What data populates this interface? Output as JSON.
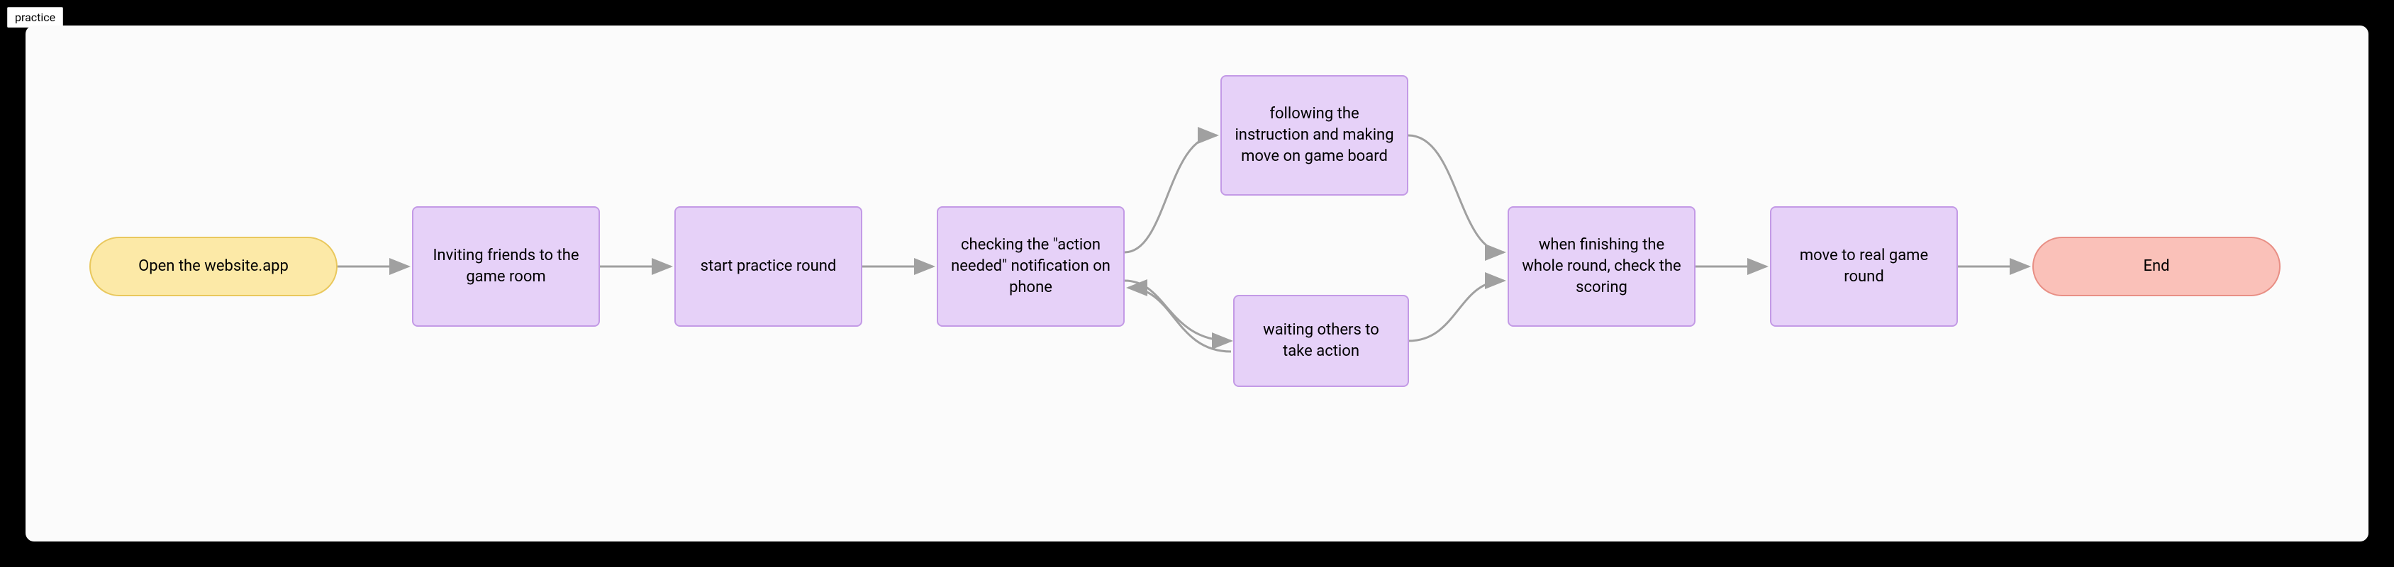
{
  "tab_label": "practice",
  "nodes": {
    "start": "Open the website.app",
    "invite": "Inviting friends to the game room",
    "practice": "start practice round",
    "check": "checking the \"action needed\" notification on phone",
    "follow": "following the instruction and making move on game board",
    "wait": "waiting others to take action",
    "finish": "when finishing the whole round, check the scoring",
    "move_real": "move to real game round",
    "end": "End"
  },
  "chart_data": {
    "type": "flowchart",
    "nodes": [
      {
        "id": "start",
        "type": "terminator",
        "label": "Open the website.app"
      },
      {
        "id": "invite",
        "type": "process",
        "label": "Inviting friends to the game room"
      },
      {
        "id": "practice",
        "type": "process",
        "label": "start practice round"
      },
      {
        "id": "check",
        "type": "process",
        "label": "checking the \"action needed\" notification on phone"
      },
      {
        "id": "follow",
        "type": "process",
        "label": "following the instruction and making move on game board"
      },
      {
        "id": "wait",
        "type": "process",
        "label": "waiting others to take action"
      },
      {
        "id": "finish",
        "type": "process",
        "label": "when finishing the whole round, check the scoring"
      },
      {
        "id": "move_real",
        "type": "process",
        "label": "move to real game round"
      },
      {
        "id": "end",
        "type": "terminator",
        "label": "End"
      }
    ],
    "edges": [
      {
        "from": "start",
        "to": "invite"
      },
      {
        "from": "invite",
        "to": "practice"
      },
      {
        "from": "practice",
        "to": "check"
      },
      {
        "from": "check",
        "to": "follow"
      },
      {
        "from": "check",
        "to": "wait"
      },
      {
        "from": "follow",
        "to": "finish"
      },
      {
        "from": "wait",
        "to": "finish"
      },
      {
        "from": "finish",
        "to": "move_real"
      },
      {
        "from": "move_real",
        "to": "end"
      },
      {
        "from": "wait",
        "to": "check",
        "note": "loop back"
      }
    ]
  }
}
